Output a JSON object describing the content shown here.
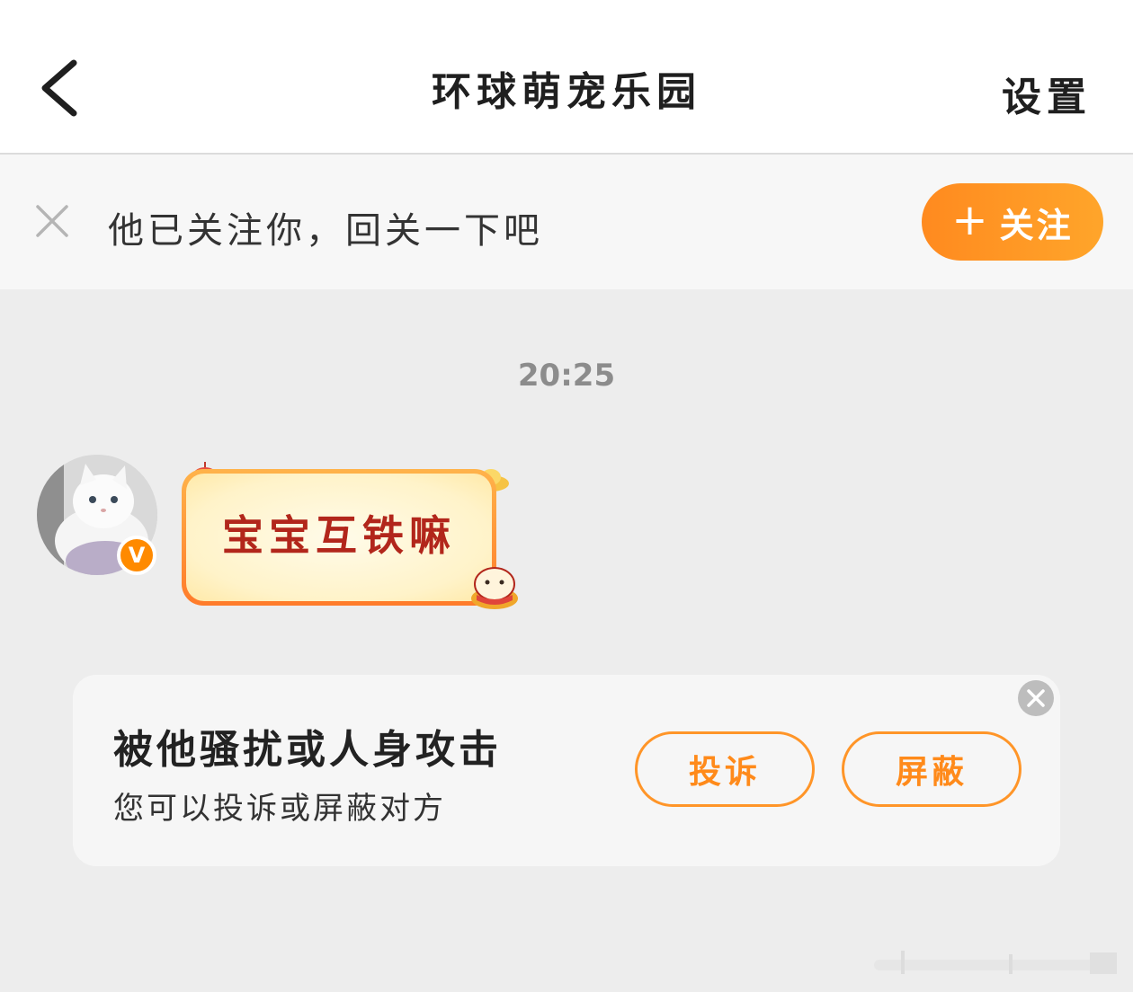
{
  "header": {
    "back_icon": "chevron-left-icon",
    "title": "环球萌宠乐园",
    "settings_label": "设置"
  },
  "follow_bar": {
    "close_icon": "close-icon",
    "text": "他已关注你，回关一下吧",
    "button_icon": "plus-icon",
    "button_label": "关注",
    "colors": {
      "button_from": "#ff8a1f",
      "button_to": "#ffa52a"
    }
  },
  "chat": {
    "timestamp": "20:25",
    "message": {
      "avatar": "white-cat-photo",
      "verified_badge": "V",
      "sticker_text": "宝宝互铁嘛"
    }
  },
  "report_card": {
    "title": "被他骚扰或人身攻击",
    "subtitle": "您可以投诉或屏蔽对方",
    "complain_label": "投诉",
    "block_label": "屏蔽",
    "close_icon": "close-circle-icon",
    "accent_color": "#ff8a1a"
  }
}
